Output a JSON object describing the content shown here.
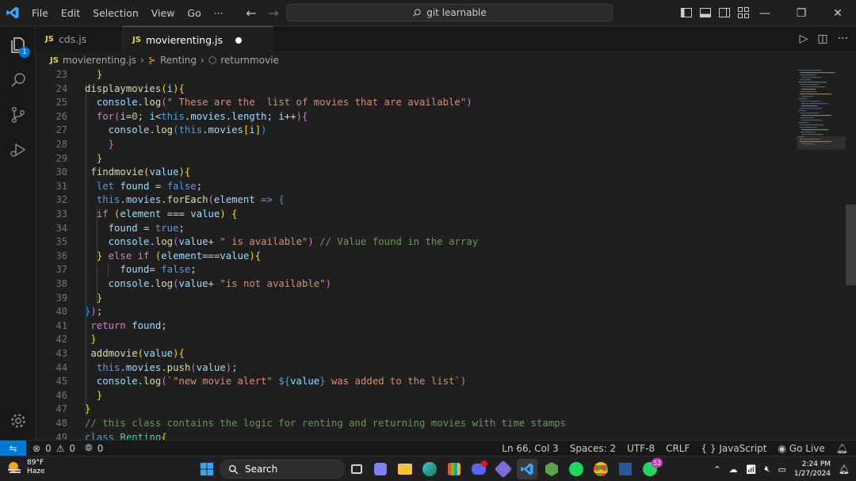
{
  "titlebar": {
    "menu": [
      "File",
      "Edit",
      "Selection",
      "View",
      "Go",
      "···"
    ],
    "search": "git learnable"
  },
  "activity": {
    "explorer_badge": "1"
  },
  "tabs": [
    {
      "icon": "JS",
      "label": "cds.js"
    },
    {
      "icon": "JS",
      "label": "movierenting.js"
    }
  ],
  "breadcrumb": {
    "file_icon": "JS",
    "file": "movierenting.js",
    "class": "Renting",
    "method": "returnmovie"
  },
  "editor": {
    "line_numbers": [
      "23",
      "24",
      "25",
      "26",
      "27",
      "28",
      "29",
      "30",
      "31",
      "32",
      "33",
      "34",
      "35",
      "36",
      "37",
      "38",
      "39",
      "40",
      "41",
      "42",
      "43",
      "44",
      "45",
      "46",
      "47",
      "48",
      "49"
    ],
    "lines": [
      "  }",
      "displaymovies(i){",
      "  console.log(\" These are the  list of movies that are available\")",
      "  for(i=0; i<this.movies.length; i++){",
      "    console.log(this.movies[i])",
      "    }",
      "  }",
      " findmovie(value){",
      "  let found = false;",
      "  this.movies.forEach(element => {",
      "  if (element === value) {",
      "    found = true;",
      "    console.log(value+ \" is available\") // Value found in the array",
      "  } else if (element===value){",
      "      found= false;",
      "    console.log(value+ \"is not available\")",
      "  }",
      "});",
      " return found;",
      " }",
      " addmovie(value){",
      "  this.movies.push(value);",
      "  console.log(`\"new movie alert\" ${value} was added to the list`)",
      "  }",
      "}",
      "// this class contains the logic for renting and returning movies with time stamps",
      "class Renting{"
    ]
  },
  "status": {
    "errors": "0",
    "warnings": "0",
    "ports": "0",
    "position": "Ln 66, Col 3",
    "spaces": "Spaces: 2",
    "encoding": "UTF-8",
    "eol": "CRLF",
    "language": "JavaScript",
    "golive": "Go Live"
  },
  "taskbar": {
    "temp": "89°F",
    "condition": "Haze",
    "search": "Search",
    "whatsapp_badge": "52",
    "time": "2:24 PM",
    "date": "1/27/2024"
  }
}
